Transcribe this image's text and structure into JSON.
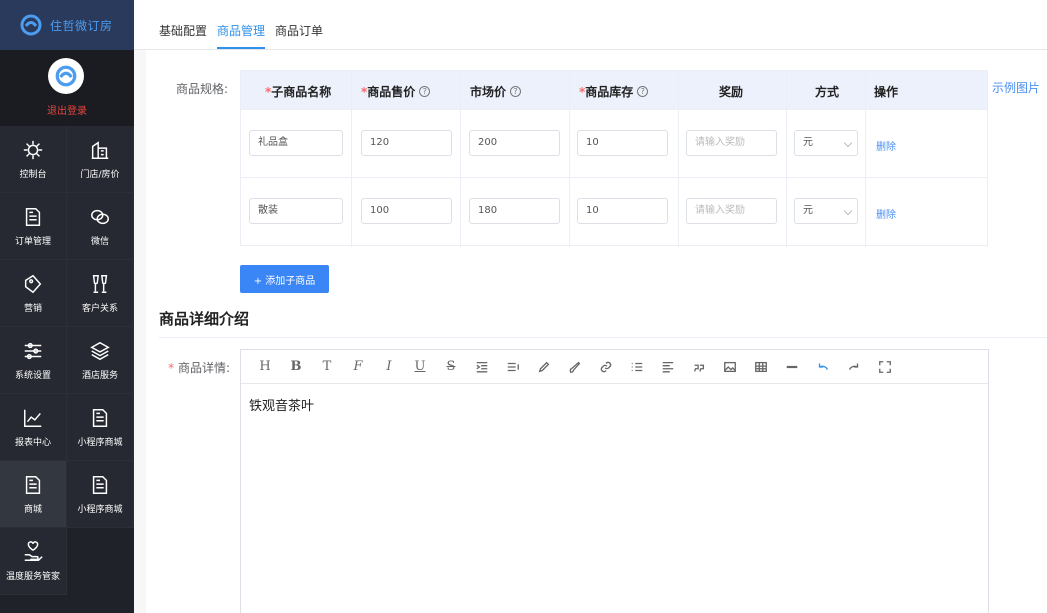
{
  "app": {
    "title": "住哲微订房",
    "logout": "退出登录"
  },
  "colors": {
    "accent": "#2f8fe9",
    "sidebar_bg": "#1f2229",
    "logout": "#e8453c"
  },
  "menu": [
    {
      "label": "控制台",
      "icon": "sun-gear-icon"
    },
    {
      "label": "门店/房价",
      "icon": "building-icon"
    },
    {
      "label": "订单管理",
      "icon": "document-icon"
    },
    {
      "label": "微信",
      "icon": "wechat-icon"
    },
    {
      "label": "营销",
      "icon": "tag-icon"
    },
    {
      "label": "客户关系",
      "icon": "glasses-icon"
    },
    {
      "label": "系统设置",
      "icon": "sliders-icon"
    },
    {
      "label": "酒店服务",
      "icon": "layers-icon"
    },
    {
      "label": "报表中心",
      "icon": "chart-icon"
    },
    {
      "label": "小程序商城",
      "icon": "document-icon"
    },
    {
      "label": "商城",
      "icon": "document-icon"
    },
    {
      "label": "小程序商城",
      "icon": "document-icon"
    },
    {
      "label": "温度服务管家",
      "icon": "hand-heart-icon"
    }
  ],
  "tabs": [
    "基础配置",
    "商品管理",
    "商品订单"
  ],
  "active_tab": "商品管理",
  "spec": {
    "label": "商品规格:",
    "example_link": "示例图片",
    "headers": {
      "name": "子商品名称",
      "price": "商品售价",
      "market": "市场价",
      "stock": "商品库存",
      "reward": "奖励",
      "mode": "方式",
      "action": "操作"
    },
    "rows": [
      {
        "name": "礼品盒",
        "price": "120",
        "market": "200",
        "stock": "10",
        "reward_placeholder": "请输入奖励",
        "mode": "元",
        "delete": "删除"
      },
      {
        "name": "散装",
        "price": "100",
        "market": "180",
        "stock": "10",
        "reward_placeholder": "请输入奖励",
        "mode": "元",
        "delete": "删除"
      }
    ],
    "add_button": "+ 添加子商品"
  },
  "detail": {
    "section_title": "商品详细介绍",
    "label": "商品详情:",
    "content": "铁观音茶叶",
    "toolbar": [
      "H",
      "B",
      "T",
      "F",
      "I",
      "U",
      "S"
    ]
  }
}
